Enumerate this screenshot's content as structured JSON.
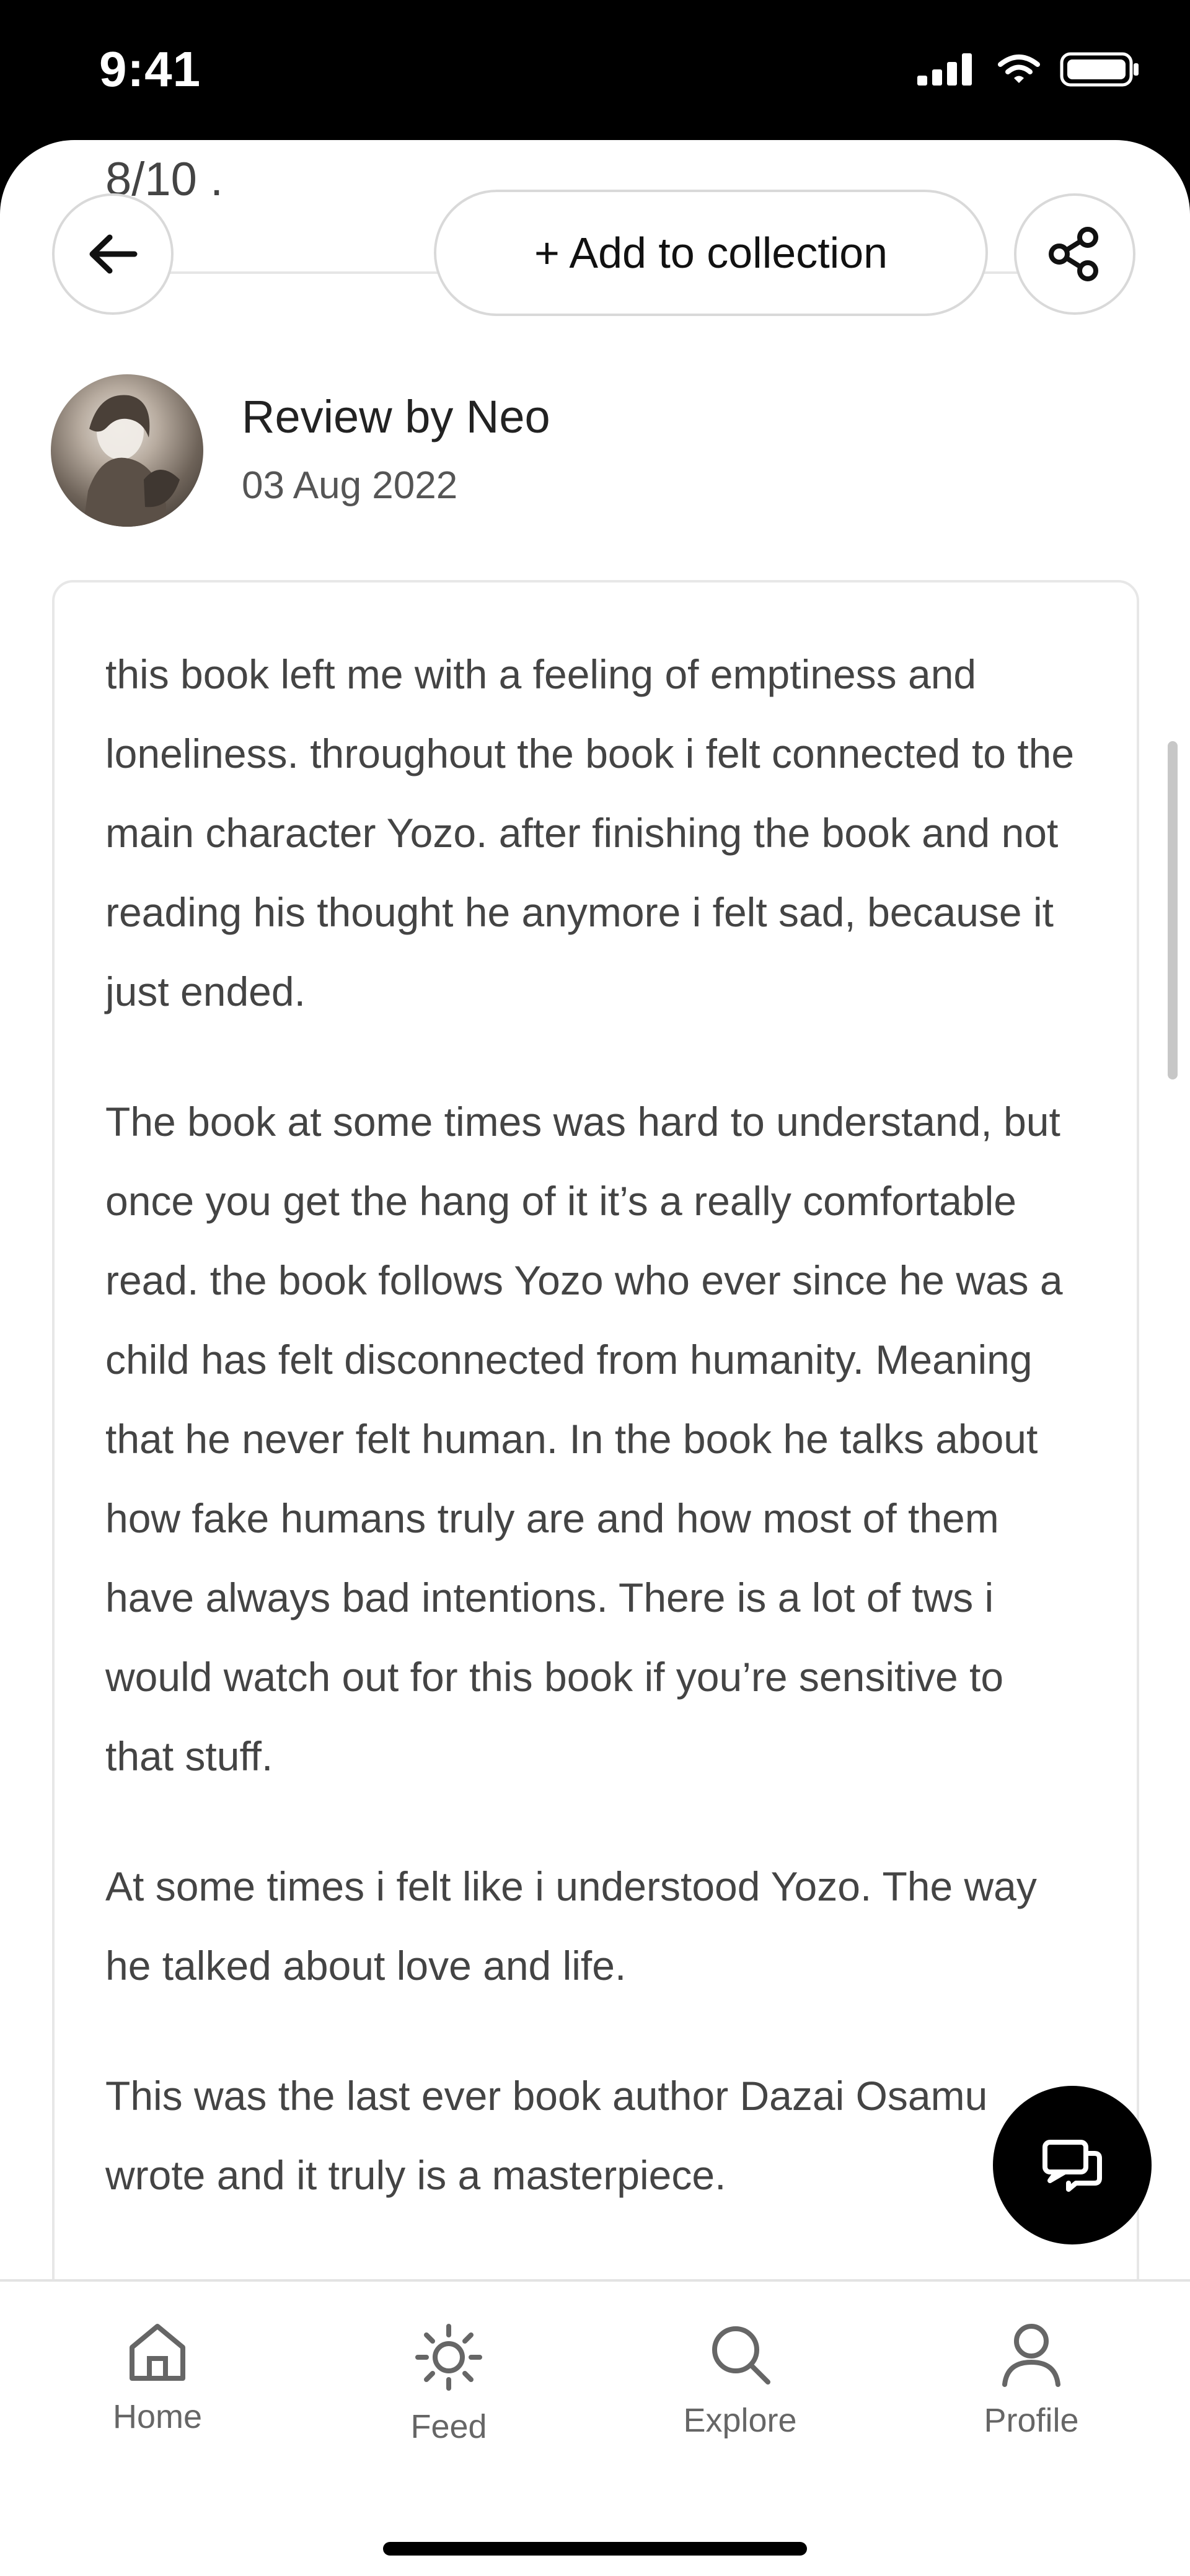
{
  "status_bar": {
    "time": "9:41"
  },
  "header": {
    "previous_rating": "8/10 .",
    "collection_button_label": "+ Add to collection",
    "back_icon": "arrow-left-icon",
    "share_icon": "share-icon"
  },
  "review": {
    "byline": "Review by Neo",
    "date": "03 Aug 2022",
    "paragraphs": [
      "this book left me with a feeling of emptiness and loneliness. throughout the book i felt connected to the main character Yozo. after finishing the book and not reading his thought he anymore i felt sad, because it just ended.",
      "The book at some times was hard to understand, but once you get the hang of it it’s a really comfortable read. the book follows Yozo who ever since he was a child has felt disconnected from humanity. Meaning that he never felt human. In the book he talks about how fake humans truly are and how most of them have always bad intentions. There is a lot of tws i would watch out for this book if you’re sensitive to that stuff.",
      "At some times i felt like i understood Yozo. The way he talked about love and life.",
      "This was the last ever book author Dazai Osamu wrote and it truly is a masterpiece."
    ]
  },
  "nav": {
    "items": [
      {
        "label": "Home",
        "icon": "home-icon"
      },
      {
        "label": "Feed",
        "icon": "sun-icon"
      },
      {
        "label": "Explore",
        "icon": "search-icon"
      },
      {
        "label": "Profile",
        "icon": "user-icon"
      }
    ]
  },
  "chat_fab_icon": "chat-icon",
  "colors": {
    "background": "#ffffff",
    "status_bar": "#000000",
    "text_primary": "#222222",
    "text_secondary": "#444444",
    "nav_text": "#666666"
  }
}
